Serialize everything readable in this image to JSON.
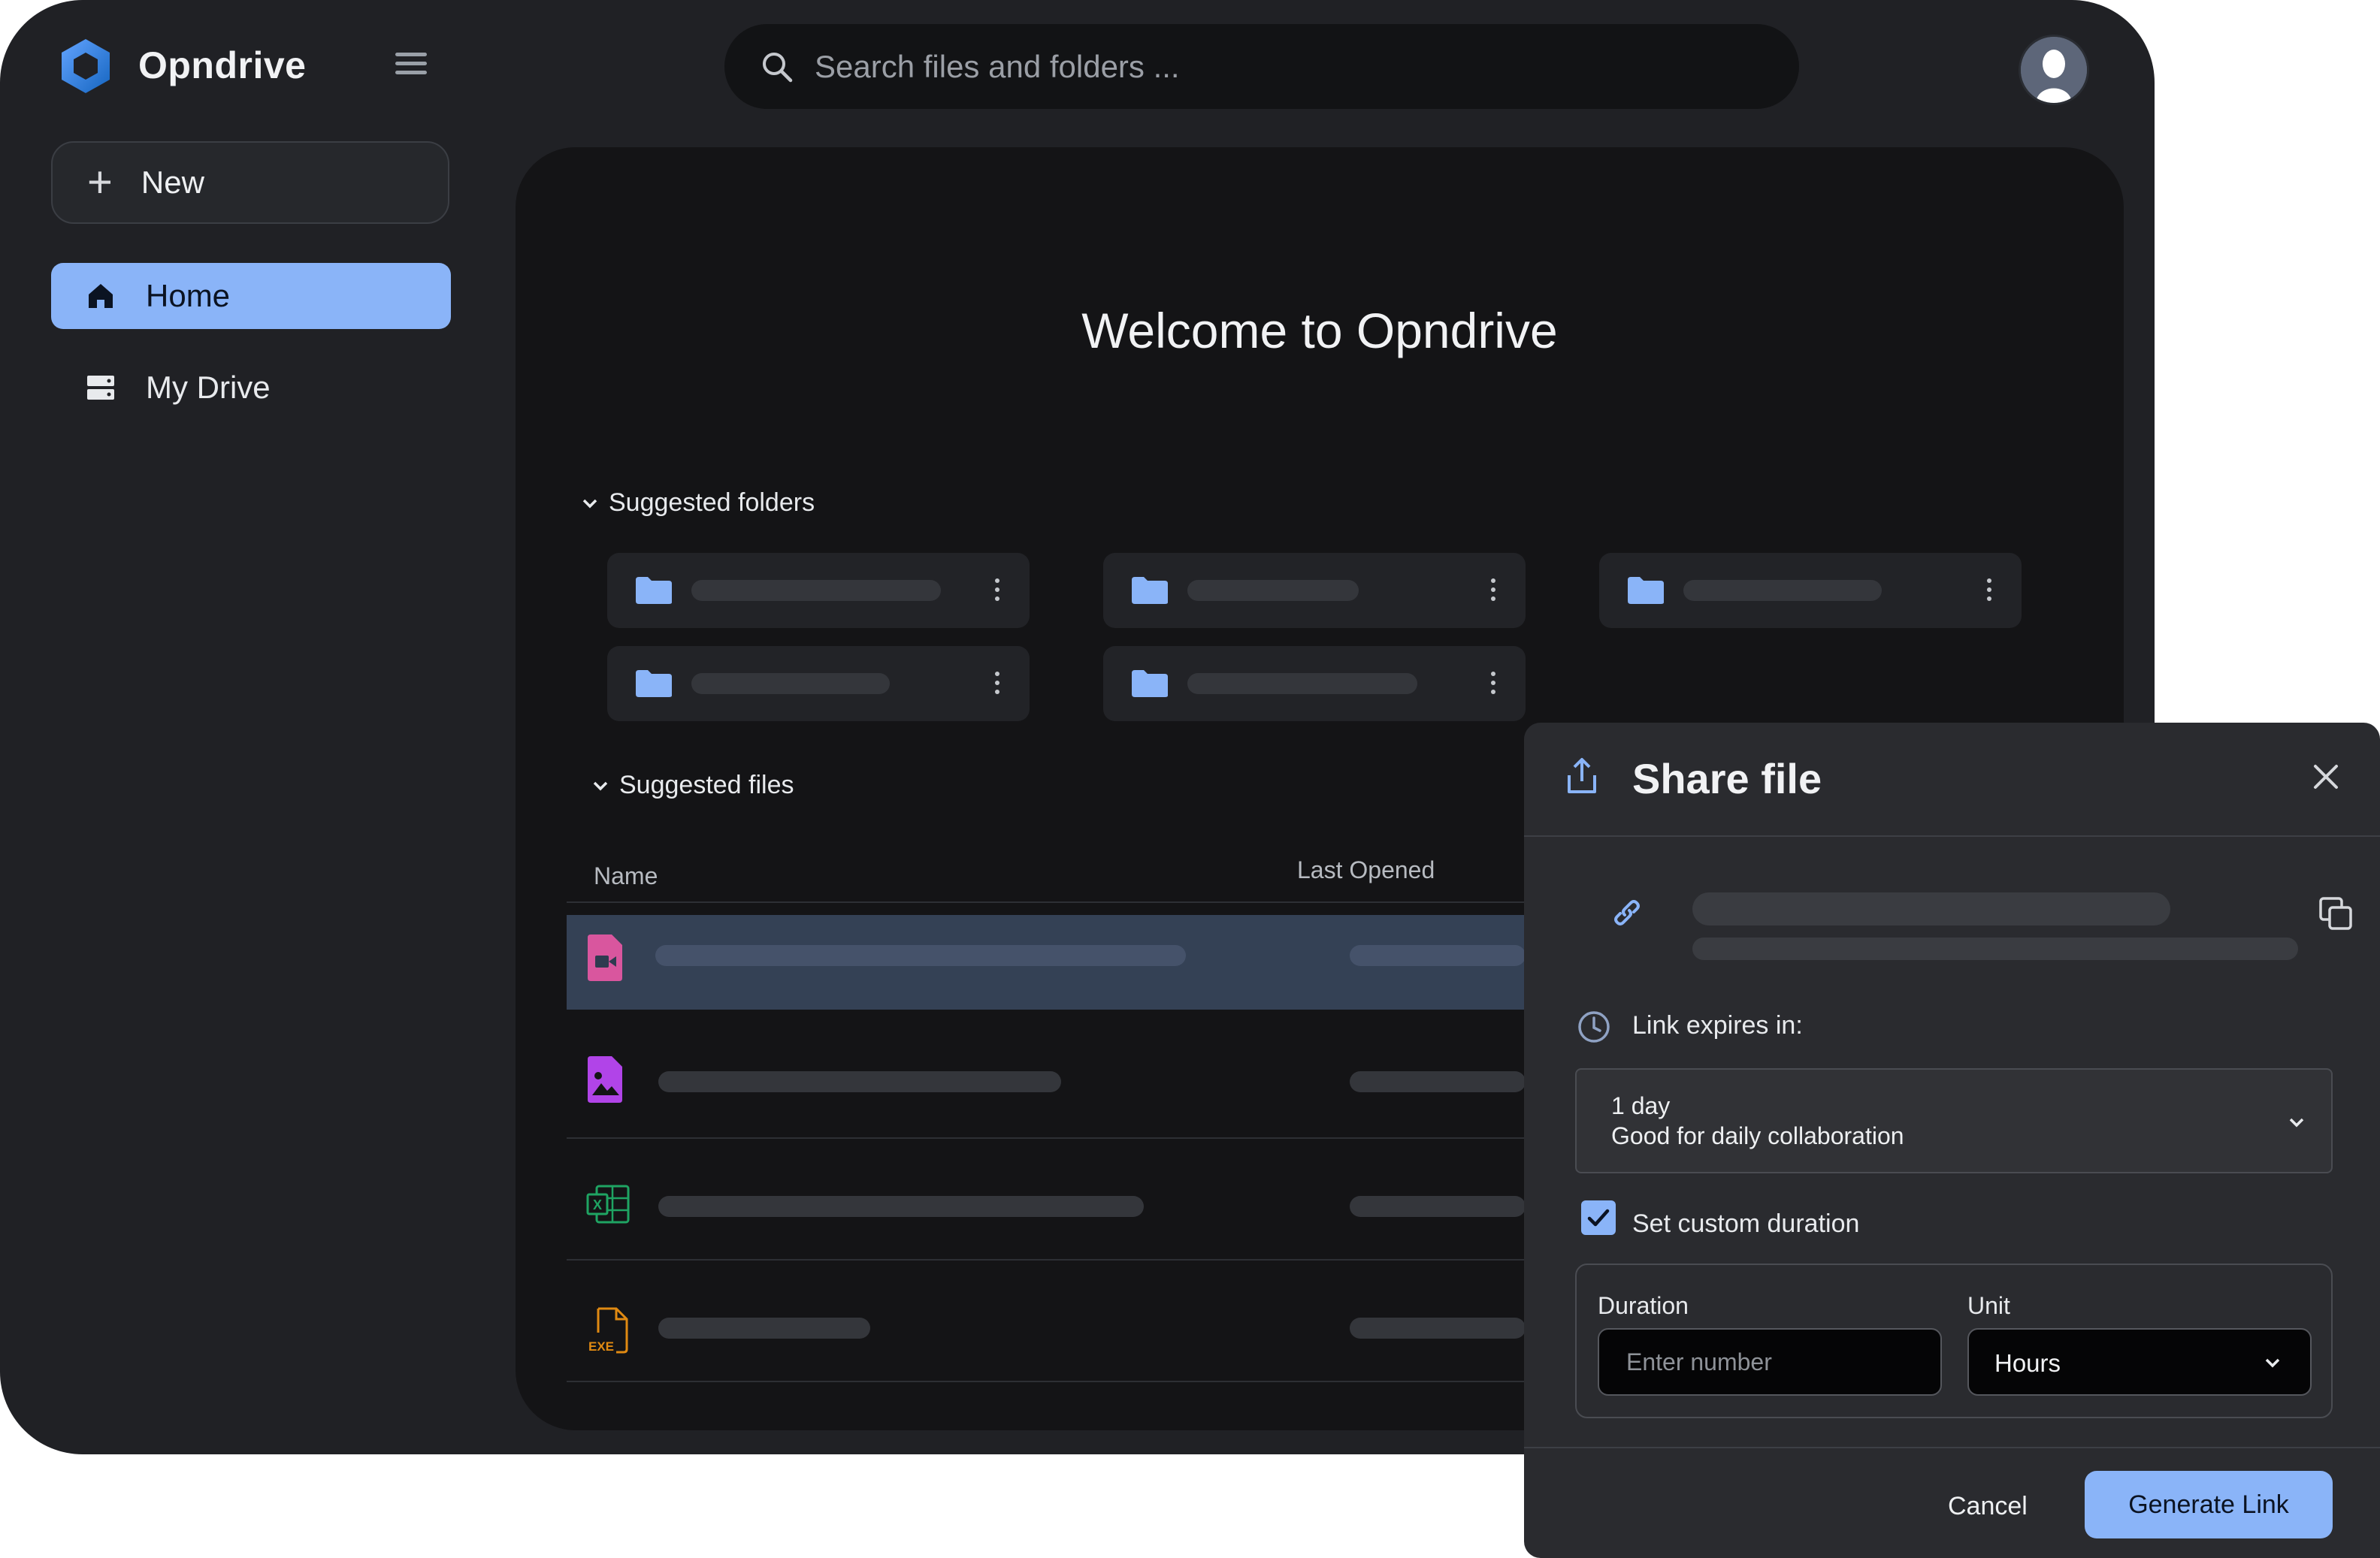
{
  "app": {
    "name": "Opndrive",
    "logo_icon": "hexagon-logo-icon"
  },
  "search": {
    "placeholder": "Search files and folders ..."
  },
  "sidebar": {
    "new_label": "New",
    "items": [
      {
        "label": "Home",
        "icon": "home-icon",
        "active": true
      },
      {
        "label": "My Drive",
        "icon": "drive-icon",
        "active": false
      }
    ]
  },
  "main": {
    "welcome": "Welcome to Opndrive",
    "suggested_folders_label": "Suggested folders",
    "suggested_files_label": "Suggested files",
    "table": {
      "col_name": "Name",
      "col_last_opened": "Last Opened"
    },
    "file_icons": [
      "video-file-icon",
      "image-file-icon",
      "spreadsheet-file-icon",
      "exe-file-icon"
    ]
  },
  "dialog": {
    "title": "Share file",
    "expires_label": "Link expires in:",
    "expiry_option_value": "1 day",
    "expiry_option_desc": "Good for daily collaboration",
    "custom_duration_label": "Set custom duration",
    "custom_duration_checked": true,
    "duration_label": "Duration",
    "duration_placeholder": "Enter number",
    "unit_label": "Unit",
    "unit_value": "Hours",
    "cancel_label": "Cancel",
    "generate_label": "Generate Link"
  },
  "colors": {
    "accent": "#8ab4f8",
    "bg": "#202125",
    "panel": "#141416"
  }
}
